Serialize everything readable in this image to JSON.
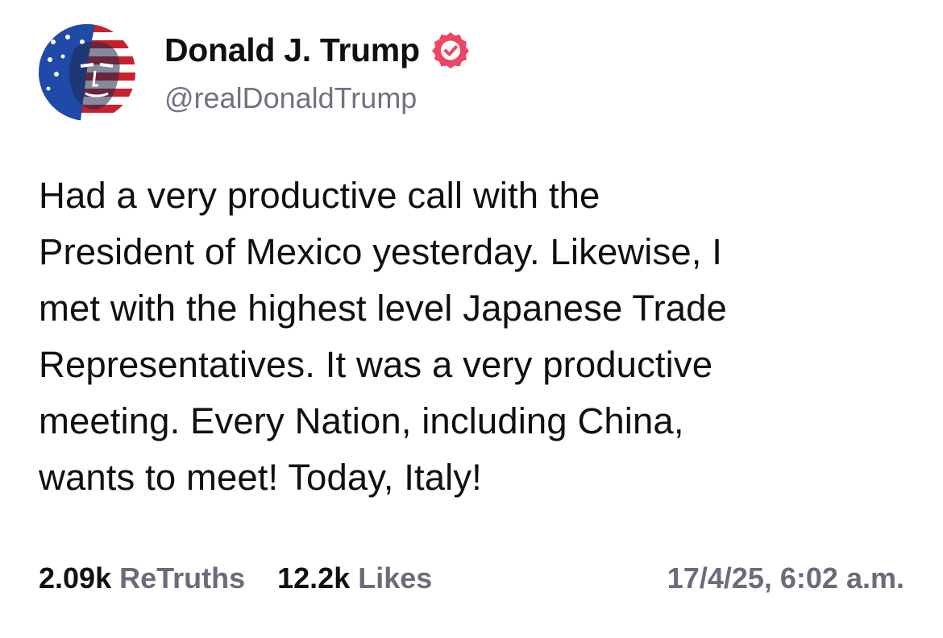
{
  "author": {
    "display_name": "Donald J. Trump",
    "handle": "@realDonaldTrump",
    "verified": true,
    "avatar_icon": "flag-portrait-avatar",
    "verified_icon": "verified-badge-icon"
  },
  "post": {
    "lines": [
      "Had a very productive call with the",
      "President of Mexico yesterday. Likewise, I",
      "met with the highest level Japanese Trade",
      "Representatives. It was a very productive",
      "meeting. Every Nation, including China,",
      "wants to meet! Today, Italy!"
    ]
  },
  "stats": {
    "retruths_count": "2.09k",
    "retruths_label": "ReTruths",
    "likes_count": "12.2k",
    "likes_label": "Likes",
    "timestamp": "17/4/25, 6:02 a.m."
  },
  "colors": {
    "text": "#0f0f14",
    "muted": "#6b6b7b",
    "verified_badge": "#ee4466"
  }
}
